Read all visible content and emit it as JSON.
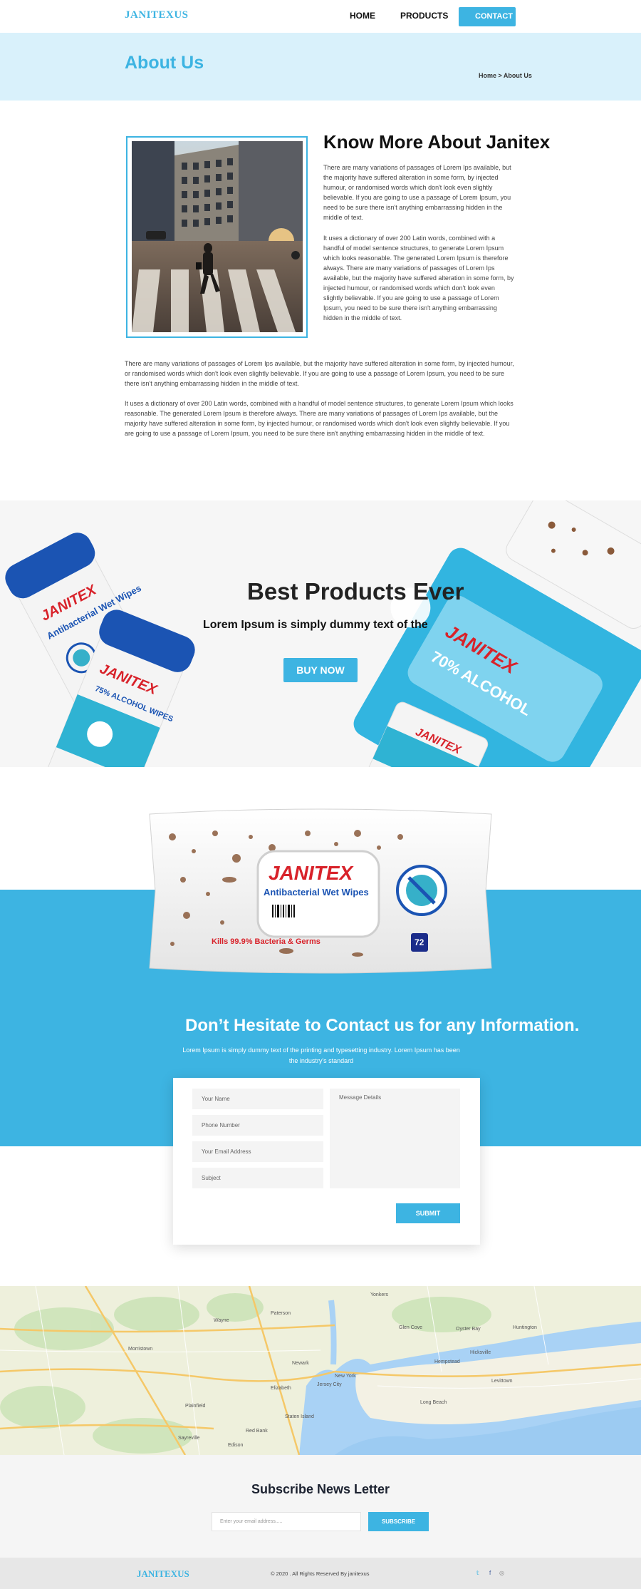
{
  "nav": {
    "logo": "JANITEXUS",
    "home": "HOME",
    "products": "PRODUCTS",
    "contact": "CONTACT"
  },
  "banner": {
    "title": "About Us",
    "breadcrumb": "Home > About Us"
  },
  "about": {
    "title": "Know More About Janitex",
    "para1": "There are many variations of passages of Lorem Ips available, but the majority have suffered alteration in some form, by injected humour, or randomised words which don't look even slightly believable. If you are going to use a passage of Lorem Ipsum, you need to be sure there isn't anything embarrassing hidden in the middle of text.",
    "para2": "It uses a dictionary of over 200 Latin words, combined with a handful of model sentence structures, to generate Lorem Ipsum which looks reasonable. The generated Lorem Ipsum is therefore always. There are many variations of passages of Lorem Ips available, but the majority have suffered alteration in some form, by injected humour, or randomised words which don't look even slightly believable. If you are going to use a passage of Lorem Ipsum, you need to be sure there isn't anything embarrassing hidden in the middle of text.",
    "wide1": "There are many variations of passages of Lorem Ips available, but the majority have suffered alteration in some form, by injected humour, or randomised words which don't look even slightly believable. If you are going to use a passage of Lorem Ipsum, you need to be sure there isn't anything embarrassing hidden in the middle of text.",
    "wide2": "It uses a dictionary of over 200 Latin words, combined with a handful of model sentence structures, to generate Lorem Ipsum which looks reasonable. The generated Lorem Ipsum is therefore always. There are many variations of passages of Lorem Ips available, but the majority have suffered alteration in some form, by injected humour, or randomised words which don't look even slightly believable. If you are going to use a passage of Lorem Ipsum, you need to be sure there isn't anything embarrassing hidden in the middle of text."
  },
  "products": {
    "title": "Best Products Ever",
    "subtitle": "Lorem Ipsum is simply dummy text of the",
    "cta": "BUY NOW",
    "tub_brand": "JANITEX",
    "tub1_label": "Antibacterial Wet Wipes",
    "tub2_label": "75% ALCOHOL WIPES",
    "pack_label": "70% ALCOHOL"
  },
  "contact": {
    "pack_brand": "JANITEX",
    "pack_label": "Antibacterial Wet Wipes",
    "pack_kills": "Kills 99.9% Bacteria & Germs",
    "pack_count": "72",
    "title": "Don’t Hesitate to Contact us for any Information.",
    "description": "Lorem Ipsum is simply dummy text of the printing and typesetting industry. Lorem Ipsum has been the industry's standard",
    "name_placeholder": "Your Name",
    "phone_placeholder": "Phone Number",
    "email_placeholder": "Your Email Address",
    "subject_placeholder": "Subject",
    "message_placeholder": "Message Details",
    "submit": "SUBMIT"
  },
  "map": {
    "labels": [
      "Yonkers",
      "Newark",
      "New York",
      "Elizabeth",
      "Edison",
      "Hempstead",
      "Long Beach",
      "Hicksville",
      "Levittown",
      "Huntington",
      "Oyster Bay",
      "Glen Cove",
      "Paterson",
      "Wayne",
      "Morristown",
      "Plainfield",
      "Sayreville",
      "Red Bank",
      "Staten Island",
      "Jersey City"
    ]
  },
  "subscribe": {
    "title": "Subscribe News Letter",
    "placeholder": "Enter your email address.....",
    "button": "SUBSCRIBE"
  },
  "footer": {
    "logo": "JANITEXUS",
    "copyright": "© 2020 . All Rights Reserved By janitexus",
    "twitter": "𝕥",
    "facebook": "f",
    "instagram": "◎"
  },
  "colors": {
    "accent": "#3db4e2",
    "banner_bg": "#d9f1fb",
    "brand_red": "#d8222a"
  }
}
